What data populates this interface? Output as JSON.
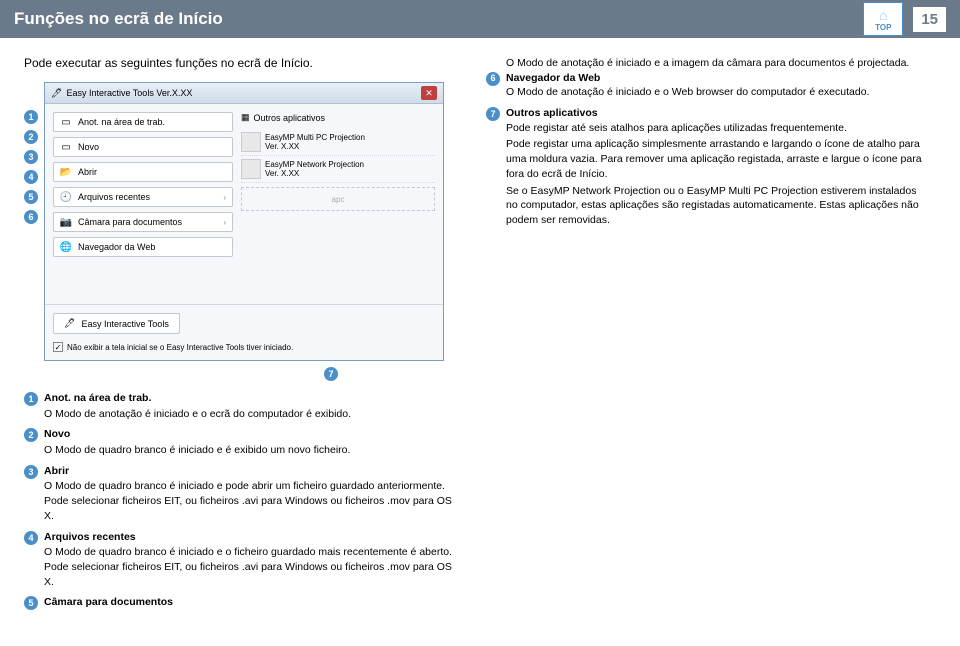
{
  "header": {
    "title": "Funções no ecrã de Início",
    "page": "15",
    "logoText": "TOP"
  },
  "intro": "Pode executar as seguintes funções no ecrã de Início.",
  "window": {
    "title": "Easy Interactive Tools Ver.X.XX",
    "menu": [
      {
        "icon": "⬜",
        "label": "Anot. na área de trab."
      },
      {
        "icon": "⬜",
        "label": "Novo"
      },
      {
        "icon": "📂",
        "label": "Abrir"
      },
      {
        "icon": "🕘",
        "label": "Arquivos recentes"
      },
      {
        "icon": "📷",
        "label": "Câmara para documentos"
      },
      {
        "icon": "🌐",
        "label": "Navegador da Web"
      }
    ],
    "appsHeader": "Outros aplicativos",
    "apps": [
      {
        "name": "EasyMP Multi PC Projection",
        "ver": "Ver. X.XX"
      },
      {
        "name": "EasyMP Network Projection",
        "ver": "Ver. X.XX"
      }
    ],
    "dropLabel": "apc",
    "eitButton": "Easy Interactive Tools",
    "checkboxLabel": "Não exibir a tela inicial se o Easy Interactive Tools tiver iniciado."
  },
  "leftDesc": [
    {
      "n": "1",
      "title": "Anot. na área de trab.",
      "body": "O Modo de anotação é iniciado e o ecrã do computador é exibido."
    },
    {
      "n": "2",
      "title": "Novo",
      "body": "O Modo de quadro branco é iniciado e é exibido um novo ficheiro."
    },
    {
      "n": "3",
      "title": "Abrir",
      "body": "O Modo de quadro branco é iniciado e pode abrir um ficheiro guardado anteriormente. Pode selecionar ficheiros EIT, ou ficheiros .avi para Windows ou ficheiros .mov para OS X."
    },
    {
      "n": "4",
      "title": "Arquivos recentes",
      "body": "O Modo de quadro branco é iniciado e o ficheiro guardado mais recentemente é aberto. Pode selecionar ficheiros EIT, ou ficheiros .avi para Windows ou ficheiros .mov para OS X."
    },
    {
      "n": "5",
      "title": "Câmara para documentos",
      "body": ""
    }
  ],
  "rightDesc": {
    "line1": "O Modo de anotação é iniciado e a imagem da câmara para documentos é projectada.",
    "item6": {
      "n": "6",
      "title": "Navegador da Web",
      "body": "O Modo de anotação é iniciado e o Web browser do computador é executado."
    },
    "item7": {
      "n": "7",
      "title": "Outros aplicativos",
      "p1": "Pode registar até seis atalhos para aplicações utilizadas frequentemente.",
      "p2": "Pode registar uma aplicação simplesmente arrastando e largando o ícone de atalho para uma moldura vazia. Para remover uma aplicação registada, arraste e largue o ícone para fora do ecrã de Início.",
      "p3": "Se o EasyMP Network Projection ou o EasyMP Multi PC Projection estiverem instalados no computador, estas aplicações são registadas automaticamente. Estas aplicações não podem ser removidas."
    }
  }
}
